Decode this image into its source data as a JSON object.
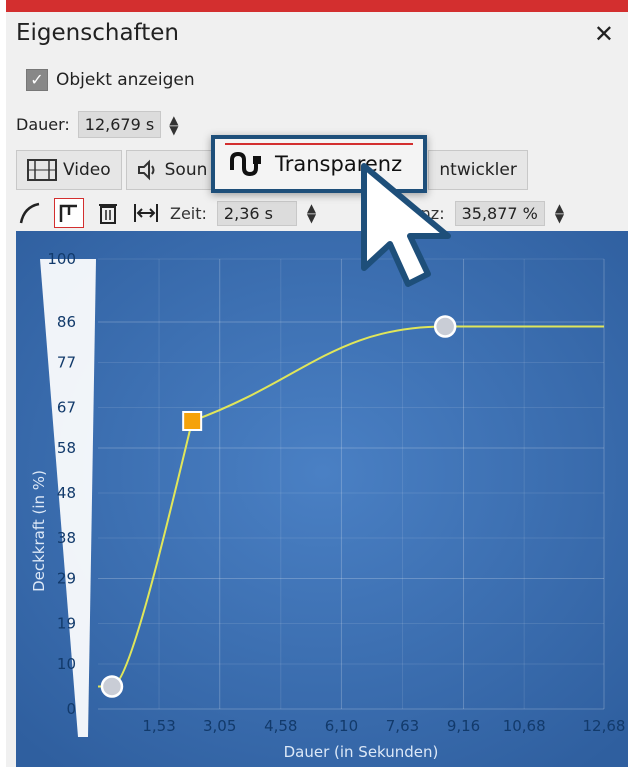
{
  "panel": {
    "title": "Eigenschaften",
    "close_glyph": "✕"
  },
  "show_object": {
    "label": "Objekt anzeigen",
    "checked": true
  },
  "duration": {
    "label": "Dauer:",
    "value": "12,679 s"
  },
  "tabs": [
    {
      "label": "Video",
      "icon": "film-icon"
    },
    {
      "label": "Soun",
      "icon": "speaker-icon"
    },
    {
      "label": "ntwickler",
      "icon": ""
    }
  ],
  "active_tab": {
    "label": "Transparenz",
    "icon": "transparency-curve-icon"
  },
  "toolbar": {
    "time_label": "Zeit:",
    "time_value": "2,36 s",
    "transparency_label": "nsparenz:",
    "transparency_value": "35,877 %"
  },
  "chart_data": {
    "type": "line",
    "ylabel": "Deckkraft (in %)",
    "xlabel": "Dauer (in Sekunden)",
    "ylim": [
      0,
      100
    ],
    "xlim": [
      0,
      12.68
    ],
    "y_ticks": [
      "0",
      "10",
      "19",
      "29",
      "38",
      "48",
      "58",
      "67",
      "77",
      "86",
      "100"
    ],
    "x_ticks": [
      "1,53",
      "3,05",
      "4,58",
      "6,10",
      "7,63",
      "9,16",
      "10,68",
      "12,68"
    ],
    "keyframes": [
      {
        "x": 0.35,
        "y": 5,
        "style": "circle"
      },
      {
        "x": 2.36,
        "y": 64,
        "style": "square-selected"
      },
      {
        "x": 8.7,
        "y": 85,
        "style": "circle"
      }
    ],
    "colors": {
      "background": "#3d6fb3",
      "line": "#e0e65a",
      "selected_keyframe": "#f5a20a"
    }
  }
}
